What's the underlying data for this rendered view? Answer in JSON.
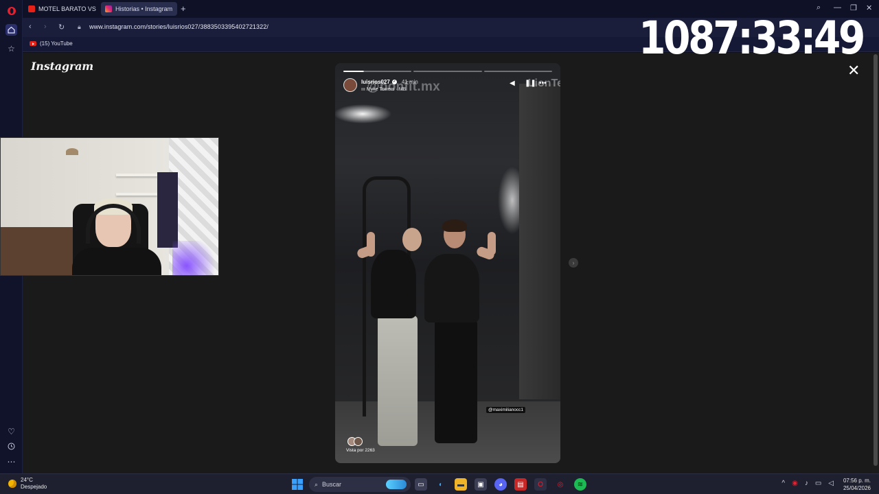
{
  "browser": {
    "tabs": [
      {
        "label": "MOTEL BARATO VS MOTE",
        "favicon": "youtube-icon",
        "active": false
      },
      {
        "label": "Historias • Instagram",
        "favicon": "instagram-icon",
        "active": true
      }
    ],
    "address": "www.instagram.com/stories/luisrios027/3883503395402721322/",
    "bookmarks": [
      {
        "label": "(15) YouTube",
        "icon": "youtube-icon"
      }
    ]
  },
  "overlay": {
    "timer": "1087:33:49"
  },
  "instagram": {
    "logo": "Instagram",
    "story": {
      "username": "luisrios027",
      "time": "41 min",
      "song": "Myke Towers · MB",
      "watermark": "@bonfit.mx",
      "watermark2": "LionTe",
      "mention": "@maximilianocc1",
      "viewed_by": "Vista por 2263",
      "segments": 3,
      "active_segment_progress": 0.3
    }
  },
  "taskbar": {
    "weather_temp": "24°C",
    "weather_desc": "Despejado",
    "search_placeholder": "Buscar",
    "time": "07:56 p. m.",
    "date": "25/04/2026"
  }
}
